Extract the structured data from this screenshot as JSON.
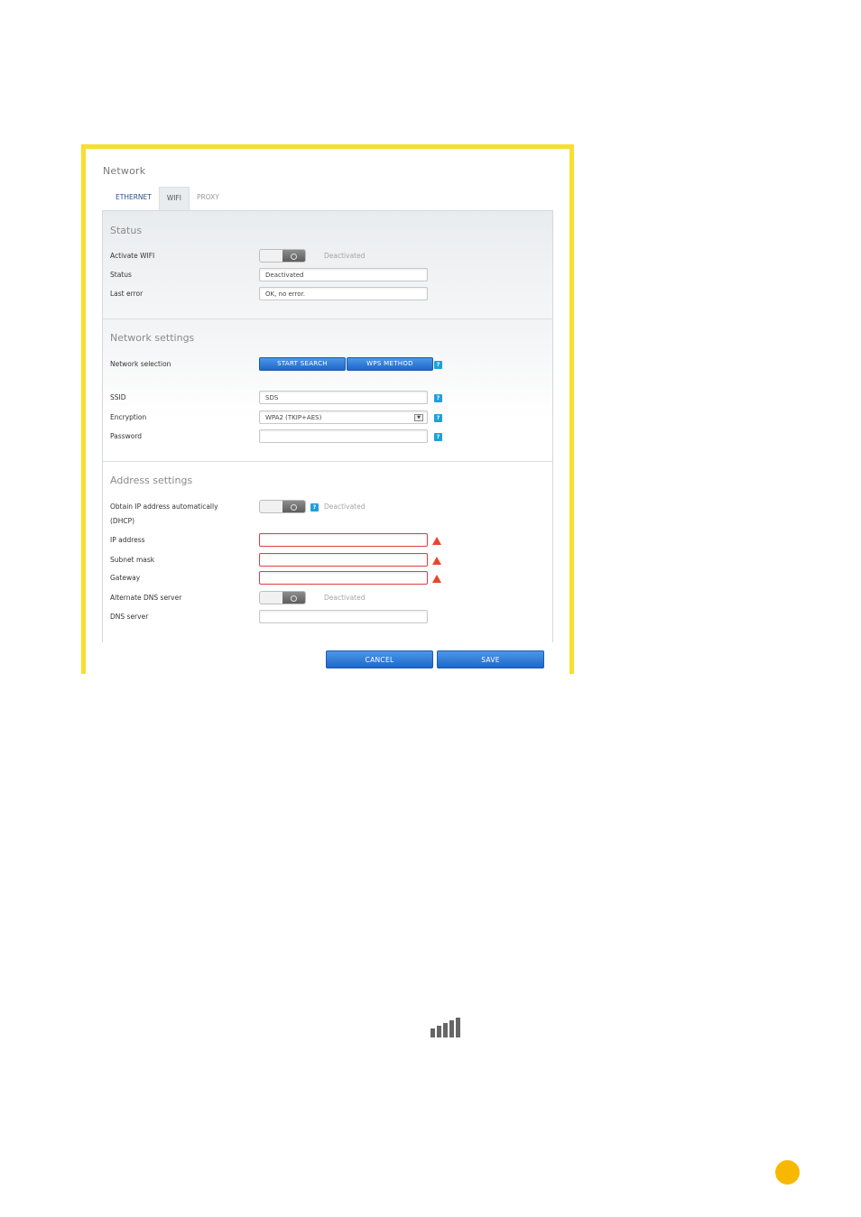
{
  "page": {
    "title": "Network",
    "tabs": [
      "ETHERNET",
      "WIFI",
      "PROXY"
    ],
    "active_tab": "WIFI"
  },
  "status": {
    "title": "Status",
    "activate_wifi_label": "Activate WIFI",
    "activate_wifi_state": "Deactivated",
    "status_label": "Status",
    "status_value": "Deactivated",
    "last_error_label": "Last error",
    "last_error_value": "OK, no error."
  },
  "network": {
    "title": "Network settings",
    "selection_label": "Network selection",
    "start_search": "START SEARCH",
    "wps_method": "WPS METHOD",
    "ssid_label": "SSID",
    "ssid_value": "SDS",
    "encryption_label": "Encryption",
    "encryption_value": "WPA2 (TKIP+AES)",
    "password_label": "Password",
    "password_value": ""
  },
  "address": {
    "title": "Address settings",
    "dhcp_label_line1": "Obtain IP address automatically",
    "dhcp_label_line2": "(DHCP)",
    "dhcp_state": "Deactivated",
    "ip_label": "IP address",
    "subnet_label": "Subnet mask",
    "gateway_label": "Gateway",
    "alt_dns_label": "Alternate DNS server",
    "alt_dns_state": "Deactivated",
    "dns_label": "DNS server"
  },
  "actions": {
    "cancel": "CANCEL",
    "save": "SAVE"
  },
  "icons": {
    "help": "?",
    "warning": "warning-icon",
    "signal": "signal-strength-icon"
  },
  "colors": {
    "frame": "#f6df2e",
    "button": "#2a78d6",
    "help": "#21a0d8",
    "warning": "#e8452e",
    "dot": "#f9b800"
  }
}
